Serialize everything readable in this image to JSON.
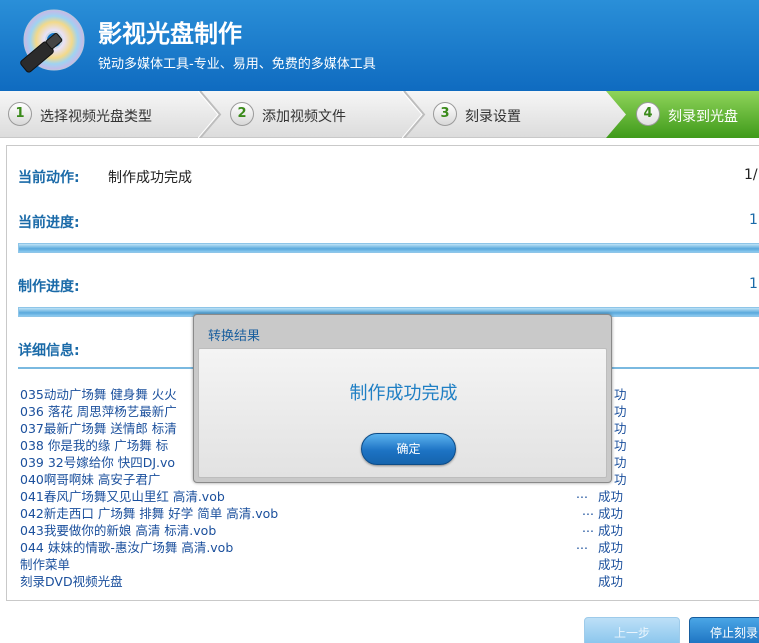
{
  "header": {
    "title": "影视光盘制作",
    "subtitle": "锐动多媒体工具-专业、易用、免费的多媒体工具"
  },
  "steps": [
    {
      "num": "1",
      "label": "选择视频光盘类型"
    },
    {
      "num": "2",
      "label": "添加视频文件"
    },
    {
      "num": "3",
      "label": "刻录设置"
    },
    {
      "num": "4",
      "label": "刻录到光盘"
    }
  ],
  "status": {
    "action_label": "当前动作:",
    "action_value": "制作成功完成",
    "action_count": "1/",
    "progress_label": "当前进度:",
    "progress_value": "1(",
    "progress_fill": 1.0,
    "make_label": "制作进度:",
    "make_value": "1(",
    "make_fill": 1.0,
    "details_label": "详细信息:"
  },
  "log": [
    {
      "text": "035动动广场舞 健身舞 火火",
      "dots": "",
      "status": "功"
    },
    {
      "text": "036 落花 周思萍杨艺最新广",
      "dots": "",
      "status": "功"
    },
    {
      "text": "037最新广场舞 送情郎 标清",
      "dots": "",
      "status": "功"
    },
    {
      "text": "038 你是我的缘 广场舞 标",
      "dots": "",
      "status": "功"
    },
    {
      "text": "039 32号嫁给你 快四DJ.vo",
      "dots": "",
      "status": "功"
    },
    {
      "text": "040啊哥啊妹    高安子君广",
      "dots": "",
      "status": "功"
    },
    {
      "text": "041春风广场舞又见山里红 高清.vob",
      "dots": "...",
      "status": "成功"
    },
    {
      "text": "042新走西口 广场舞 排舞 好学 简单 高清.vob",
      "dots": "...",
      "status": "成功"
    },
    {
      "text": "043我要做你的新娘 高清 标清.vob",
      "dots": "...",
      "status": "成功"
    },
    {
      "text": "044 妹妹的情歌-惠汝广场舞 高清.vob",
      "dots": "...",
      "status": "成功"
    },
    {
      "text": "制作菜单",
      "dots": "",
      "status": "成功"
    },
    {
      "text": "刻录DVD视频光盘",
      "dots": "",
      "status": "成功"
    }
  ],
  "dialog": {
    "title": "转换结果",
    "message": "制作成功完成",
    "ok_label": "确定"
  },
  "footer": {
    "prev_label": "上一步",
    "stop_label": "停止刻录"
  },
  "colors": {
    "header_blue": "#1577c9",
    "active_step_green": "#5cb82a",
    "label_blue": "#1a6aa8",
    "log_blue": "#1a4f9c"
  }
}
